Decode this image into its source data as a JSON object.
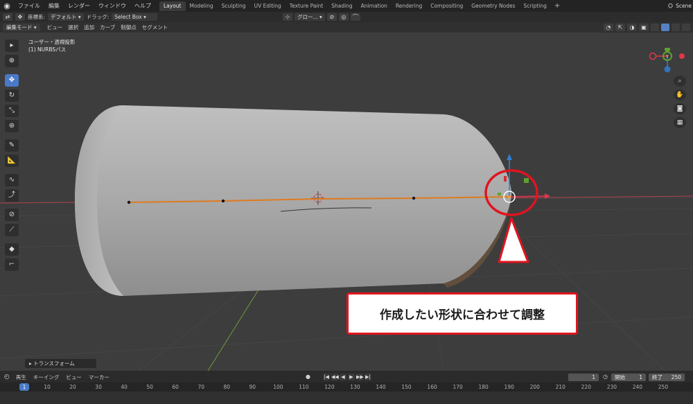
{
  "topbar": {
    "menus": [
      "ファイル",
      "編集",
      "レンダー",
      "ウィンドウ",
      "ヘルプ"
    ],
    "workspaces": [
      "Layout",
      "Modeling",
      "Sculpting",
      "UV Editing",
      "Texture Paint",
      "Shading",
      "Animation",
      "Rendering",
      "Compositing",
      "Geometry Nodes",
      "Scripting"
    ],
    "active_workspace": "Layout",
    "scene_label": "Scene"
  },
  "tool_header": {
    "orientation_label": "座標系:",
    "orientation_value": "デフォルト",
    "drag_label": "ドラッグ:",
    "drag_value": "Select Box",
    "pivot_value": "グロー..."
  },
  "view_header": {
    "mode": "編集モード",
    "menus": [
      "ビュー",
      "選択",
      "追加",
      "カーブ",
      "制御点",
      "セグメント"
    ]
  },
  "viewport": {
    "view_name": "ユーザー・透視投影",
    "object_name": "(1) NURBSパス",
    "gizmo_axes": [
      "X",
      "Y",
      "Z"
    ],
    "transform_panel_label": "トランスフォーム",
    "callout_text": "作成したい形状に合わせて調整",
    "highlight_color": "#e0141f"
  },
  "timeline": {
    "menus": [
      "再生",
      "キーイング",
      "ビュー",
      "マーカー"
    ],
    "current_frame": "1",
    "start_label": "開始",
    "start_value": "1",
    "end_label": "終了",
    "end_value": "250",
    "ruler_labels": [
      "1",
      "10",
      "20",
      "30",
      "40",
      "50",
      "60",
      "70",
      "80",
      "90",
      "100",
      "110",
      "120",
      "130",
      "140",
      "150",
      "160",
      "170",
      "180",
      "190",
      "200",
      "210",
      "220",
      "230",
      "240",
      "250"
    ]
  },
  "colors": {
    "accent": "#4a7ac7",
    "path_orange": "#e07a1f",
    "x_axis": "#e2364b",
    "y_axis": "#5ea12f",
    "z_axis": "#2f7fd6"
  }
}
